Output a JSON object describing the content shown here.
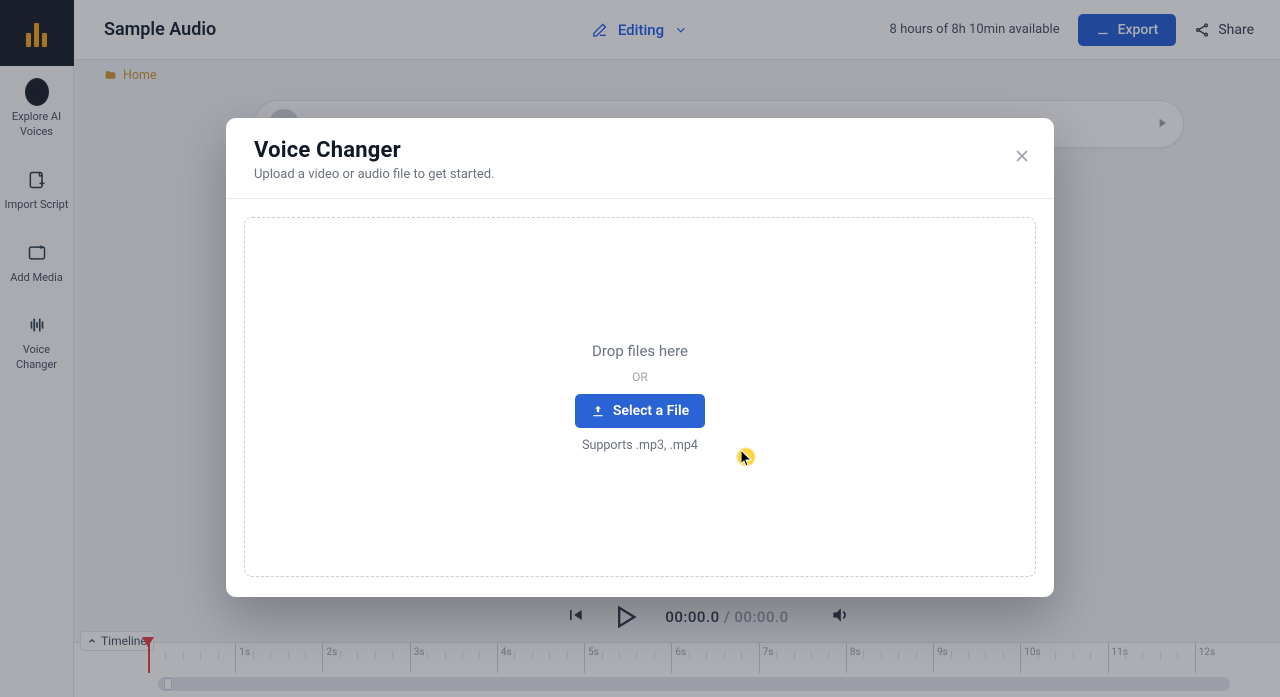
{
  "header": {
    "project_title": "Sample Audio",
    "mode_label": "Editing",
    "quota_text": "8 hours of 8h 10min available",
    "export_label": "Export",
    "share_label": "Share"
  },
  "breadcrumb": {
    "home_label": "Home"
  },
  "sidebar": {
    "items": [
      {
        "label": "Explore AI Voices"
      },
      {
        "label": "Import Script"
      },
      {
        "label": "Add Media"
      },
      {
        "label": "Voice Changer"
      }
    ]
  },
  "playback": {
    "current": "00:00.0",
    "separator": " / ",
    "total": "00:00.0"
  },
  "timeline": {
    "label": "Timeline",
    "ticks": [
      "1s",
      "2s",
      "3s",
      "4s",
      "5s",
      "6s",
      "7s",
      "8s",
      "9s",
      "10s",
      "11s",
      "12s"
    ]
  },
  "modal": {
    "title": "Voice Changer",
    "subtitle": "Upload a video or audio file to get started.",
    "drop_text": "Drop files here",
    "or_text": "OR",
    "select_label": "Select a File",
    "supports_text": "Supports .mp3, .mp4"
  },
  "colors": {
    "accent": "#2a63d4",
    "brand": "#f5a623",
    "danger": "#ef4444"
  }
}
